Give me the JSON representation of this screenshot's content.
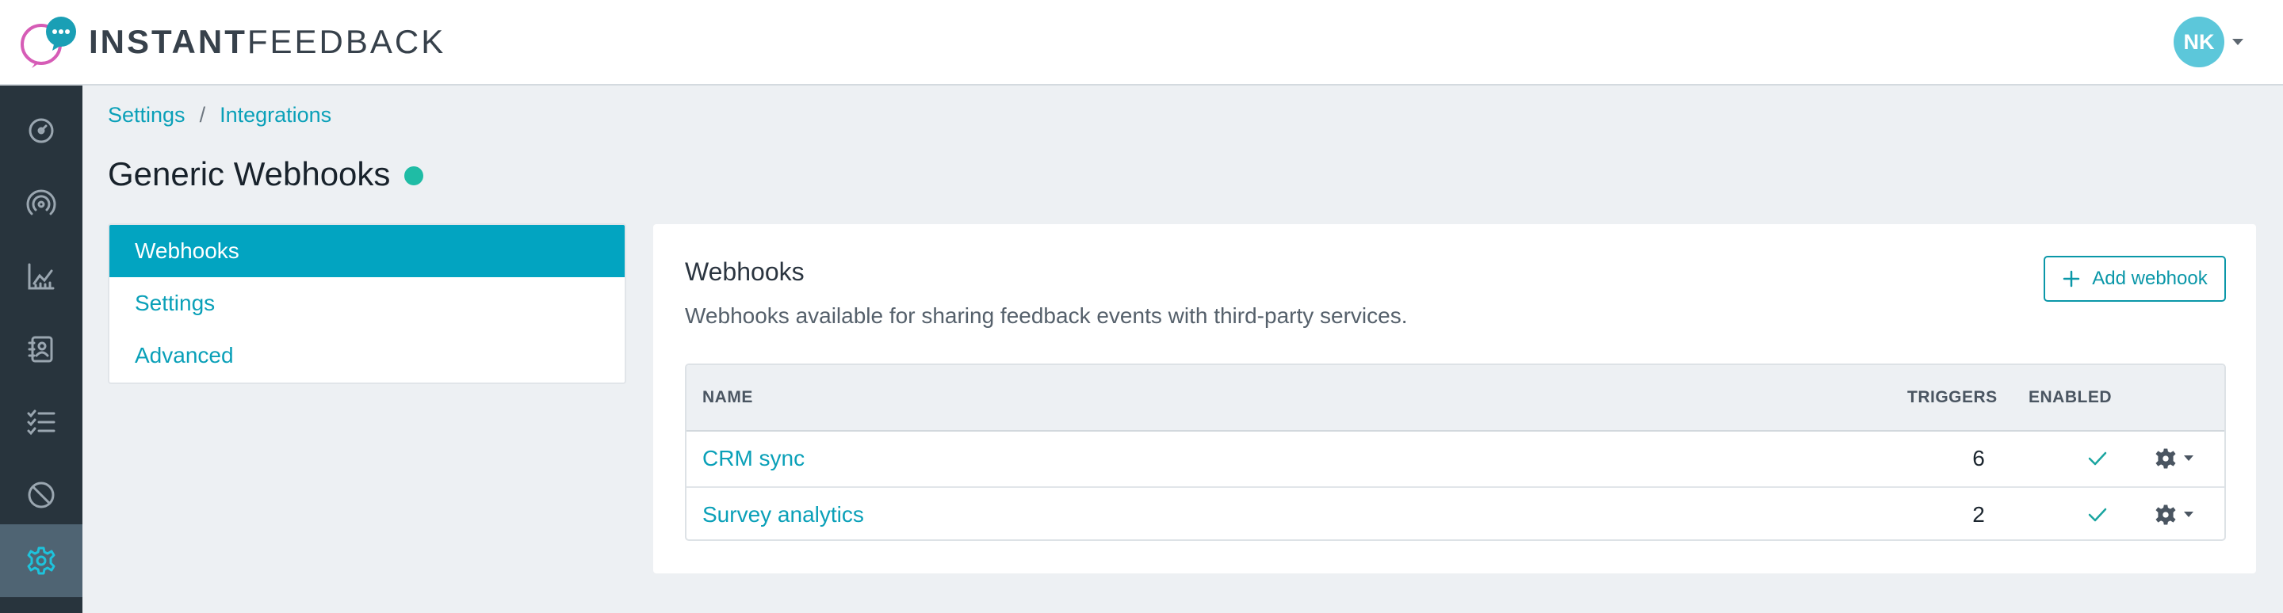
{
  "header": {
    "logo_bold": "INSTANT",
    "logo_light": "FEEDBACK",
    "avatar_initials": "NK"
  },
  "rail": {
    "items": [
      {
        "icon": "dashboard-gauge-icon"
      },
      {
        "icon": "broadcast-icon"
      },
      {
        "icon": "analytics-chart-icon"
      },
      {
        "icon": "contacts-book-icon"
      },
      {
        "icon": "checklist-icon"
      },
      {
        "icon": "blocked-icon"
      },
      {
        "icon": "settings-gear-icon",
        "active": true
      }
    ]
  },
  "breadcrumb": {
    "items": [
      "Settings",
      "Integrations"
    ],
    "separator": "/"
  },
  "page": {
    "title": "Generic Webhooks",
    "status_color": "#1fbca5"
  },
  "subnav": {
    "items": [
      {
        "label": "Webhooks",
        "active": true
      },
      {
        "label": "Settings"
      },
      {
        "label": "Advanced"
      }
    ]
  },
  "card": {
    "title": "Webhooks",
    "description": "Webhooks available for sharing feedback events with third-party services.",
    "add_button_label": "Add webhook"
  },
  "table": {
    "columns": [
      "NAME",
      "TRIGGERS",
      "ENABLED"
    ],
    "rows": [
      {
        "name": "CRM sync",
        "triggers": "6",
        "enabled": true
      },
      {
        "name": "Survey analytics",
        "triggers": "2",
        "enabled": true
      }
    ]
  },
  "colors": {
    "accent": "#0aa0b8",
    "active_subnav": "#02a4c1",
    "rail_bg": "#28343d",
    "rail_active": "#4f6473",
    "avatar_bg": "#5cc7da"
  }
}
